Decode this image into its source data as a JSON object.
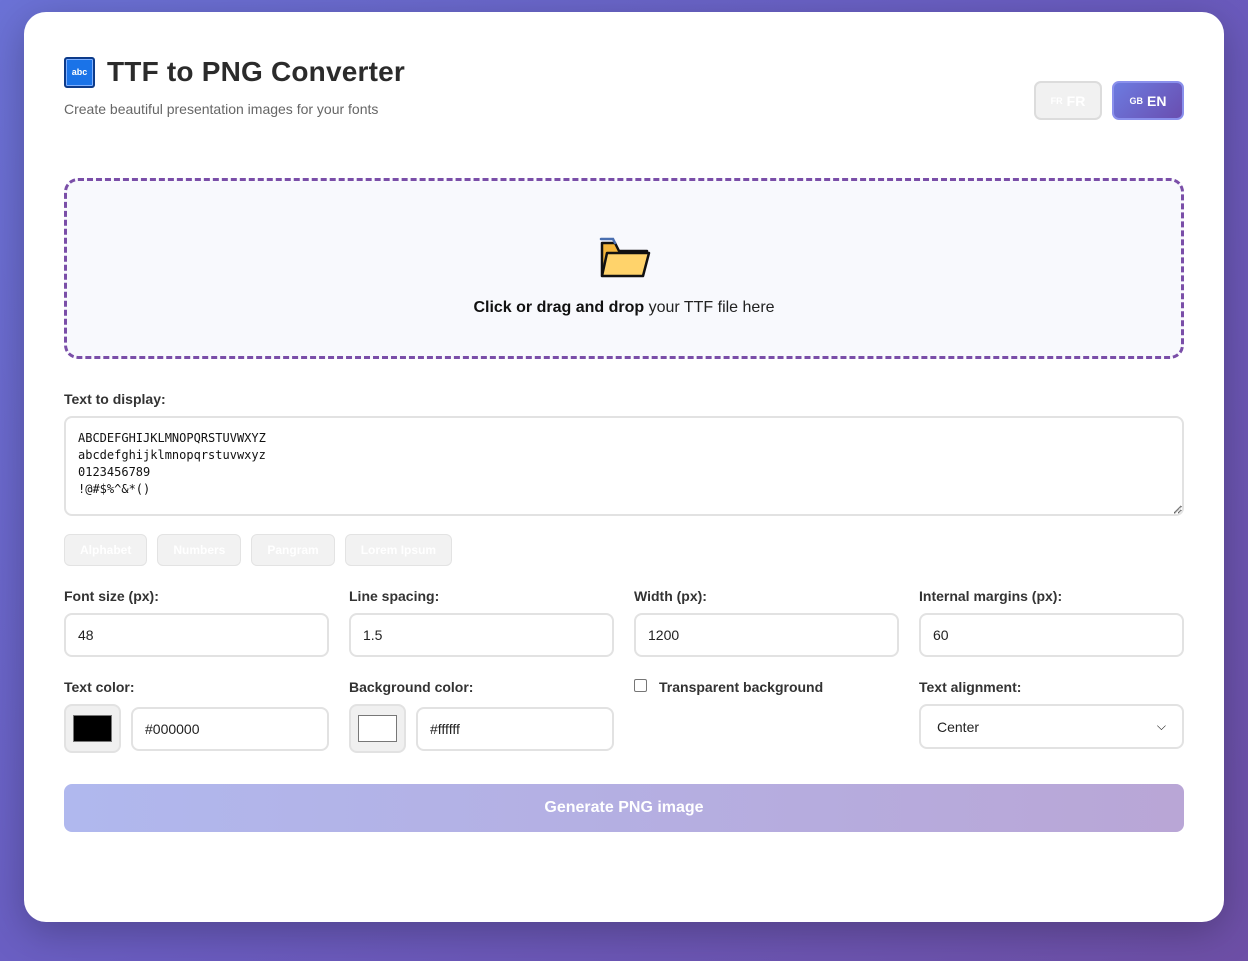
{
  "header": {
    "logo_text": "abc",
    "title": "TTF to PNG Converter",
    "subtitle": "Create beautiful presentation images for your fonts",
    "languages": [
      {
        "flag": "FR",
        "label": "FR",
        "active": false
      },
      {
        "flag": "GB",
        "label": "EN",
        "active": true
      }
    ]
  },
  "dropzone": {
    "icon": "folder-icon",
    "text_bold": "Click or drag and drop",
    "text_rest": " your TTF file here"
  },
  "text_display": {
    "label": "Text to display:",
    "value": "ABCDEFGHIJKLMNOPQRSTUVWXYZ\nabcdefghijklmnopqrstuvwxyz\n0123456789\n!@#$%^&*()"
  },
  "presets": [
    "Alphabet",
    "Numbers",
    "Pangram",
    "Lorem Ipsum"
  ],
  "settings": {
    "font_size": {
      "label": "Font size (px):",
      "value": "48"
    },
    "line_spacing": {
      "label": "Line spacing:",
      "value": "1.5"
    },
    "width": {
      "label": "Width (px):",
      "value": "1200"
    },
    "margins": {
      "label": "Internal margins (px):",
      "value": "60"
    },
    "text_color": {
      "label": "Text color:",
      "value": "#000000",
      "swatch": "#000000"
    },
    "bg_color": {
      "label": "Background color:",
      "value": "#ffffff",
      "swatch": "#ffffff"
    },
    "transparent": {
      "label": "Transparent background",
      "checked": false
    },
    "alignment": {
      "label": "Text alignment:",
      "value": "Center"
    }
  },
  "generate_label": "Generate PNG image",
  "colors": {
    "accent": "#6a4eb0",
    "dropzone_border": "#7a4ea8"
  }
}
